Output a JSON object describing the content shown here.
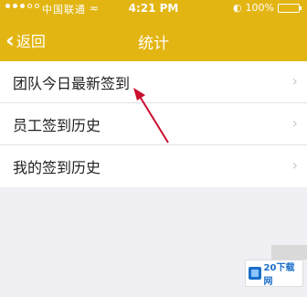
{
  "status_bar": {
    "carrier": "中国联通",
    "wifi_icon": "wifi-icon",
    "time": "4:21 PM",
    "battery_percent": "100%",
    "battery_level": 1.0
  },
  "nav": {
    "back_label": "返回",
    "title": "统计"
  },
  "menu": {
    "items": [
      {
        "label": "团队今日最新签到"
      },
      {
        "label": "员工签到历史"
      },
      {
        "label": "我的签到历史"
      }
    ]
  },
  "watermark": {
    "text": "20下载网"
  },
  "colors": {
    "accent": "#e3b512",
    "annotation_arrow": "#c8102e"
  }
}
